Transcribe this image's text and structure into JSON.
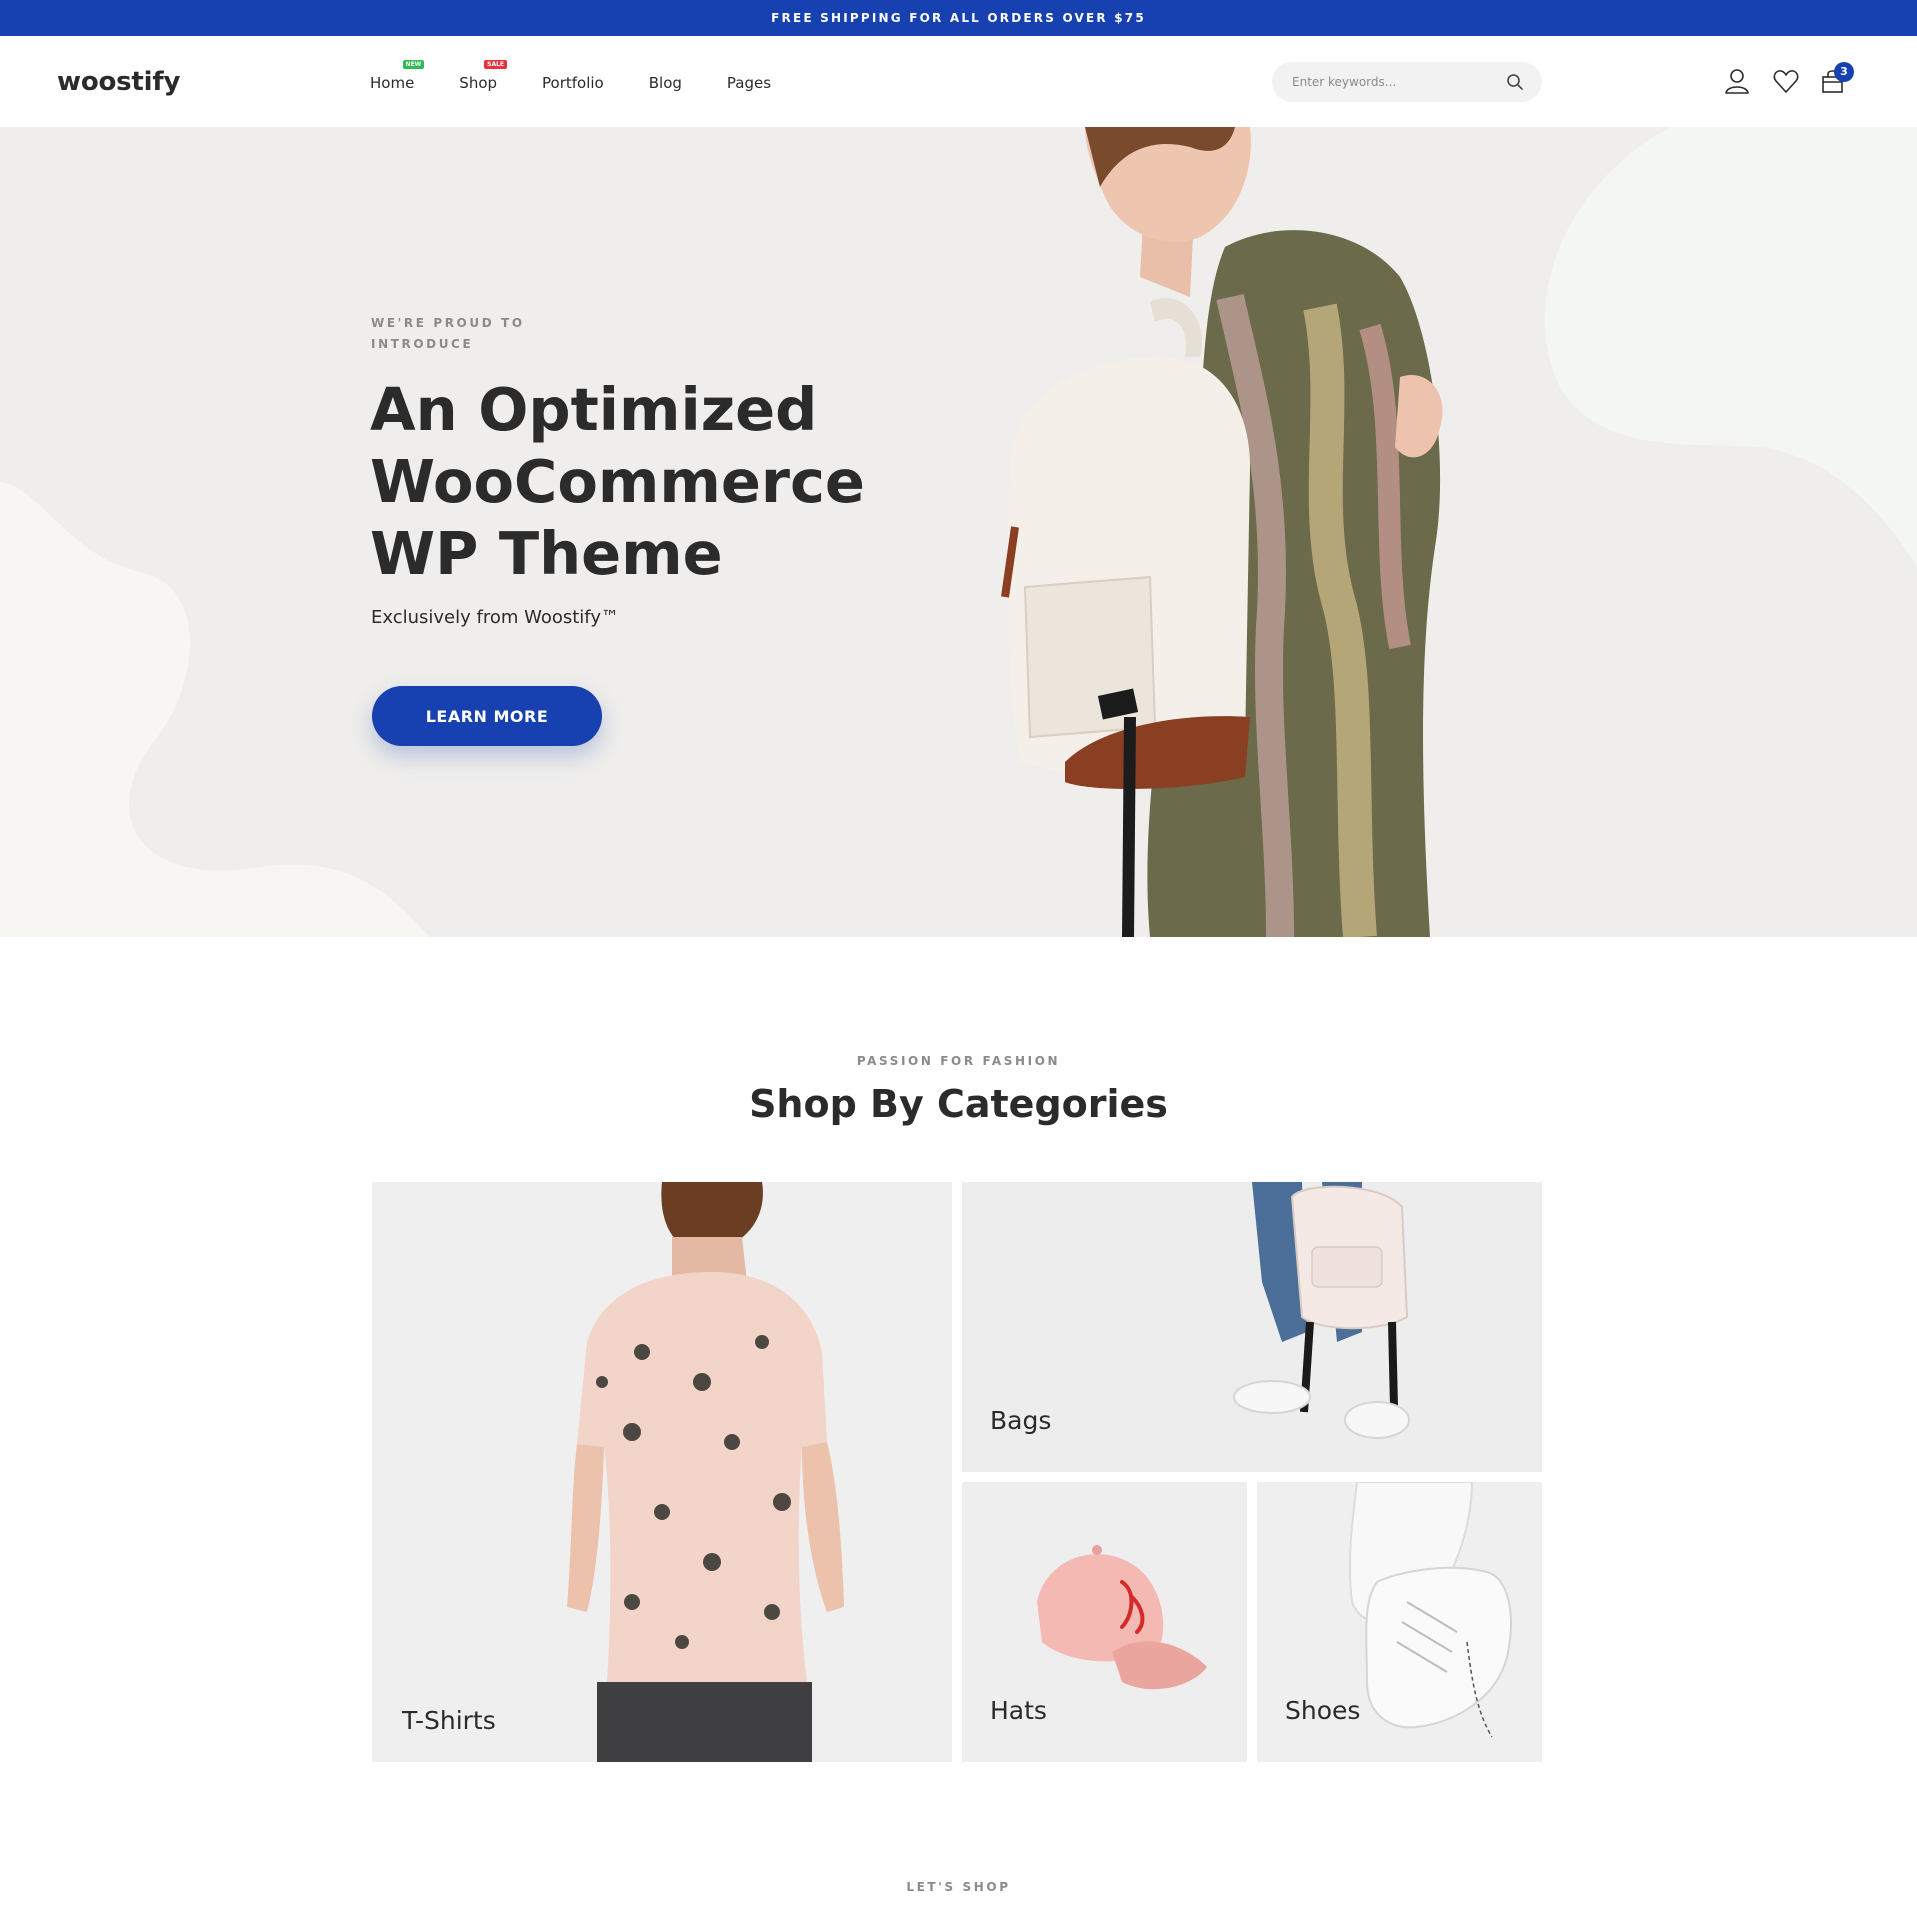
{
  "announcement": {
    "text": "FREE SHIPPING FOR ALL ORDERS OVER $75"
  },
  "header": {
    "logo": "woostify",
    "nav": [
      {
        "label": "Home",
        "badge": "NEW",
        "badge_color": "#2dbb54"
      },
      {
        "label": "Shop",
        "badge": "SALE",
        "badge_color": "#e5343d"
      },
      {
        "label": "Portfolio"
      },
      {
        "label": "Blog"
      },
      {
        "label": "Pages"
      }
    ],
    "search": {
      "placeholder": "Enter keywords..."
    },
    "icons": [
      "user-icon",
      "heart-icon",
      "cart-icon"
    ],
    "cart_count": "3"
  },
  "hero": {
    "eyebrow": "WE'RE PROUD TO INTRODUCE",
    "title_lines": [
      "An Optimized",
      "WooCommerce",
      "WP Theme"
    ],
    "subtitle": "Exclusively from Woostify™",
    "button": "LEARN MORE"
  },
  "categories": {
    "eyebrow": "PASSION FOR FASHION",
    "title": "Shop By Categories",
    "items": [
      {
        "label": "T-Shirts"
      },
      {
        "label": "Bags"
      },
      {
        "label": "Hats"
      },
      {
        "label": "Shoes"
      }
    ]
  },
  "next_section": {
    "eyebrow": "LET'S SHOP"
  },
  "colors": {
    "accent": "#1741b0",
    "text": "#2b2b2b",
    "muted": "#8b8b8b",
    "hero_bg": "#efeeec"
  }
}
